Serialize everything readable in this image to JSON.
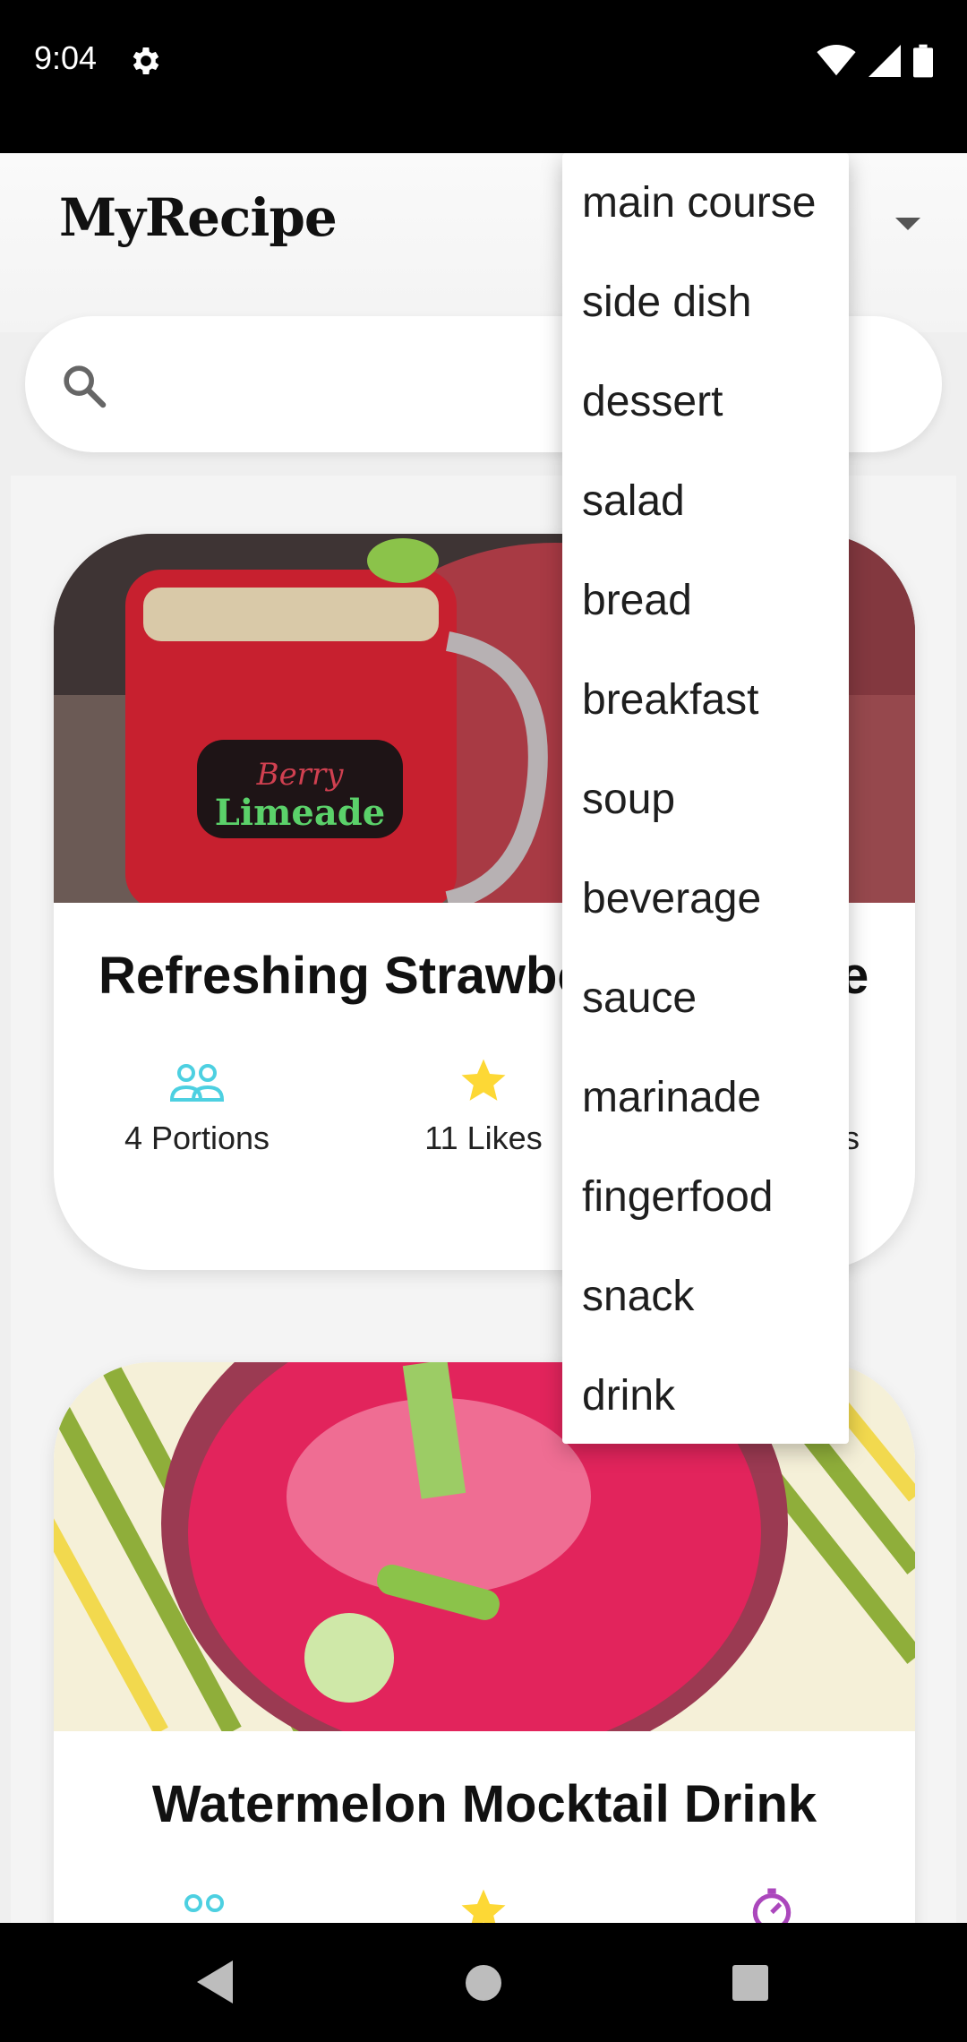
{
  "status_bar": {
    "time": "9:04",
    "icons": [
      "gear-icon",
      "wifi-icon",
      "signal-icon",
      "battery-icon"
    ]
  },
  "header": {
    "title": "MyRecipe",
    "dropdown_icon": "arrow-drop-down-icon"
  },
  "search": {
    "placeholder": "",
    "icon": "search-icon"
  },
  "category_menu": {
    "items": [
      "main course",
      "side dish",
      "dessert",
      "salad",
      "bread",
      "breakfast",
      "soup",
      "beverage",
      "sauce",
      "marinade",
      "fingerfood",
      "snack",
      "drink"
    ]
  },
  "recipes": [
    {
      "title_visible": "Refreshing Strawbe",
      "title_tail": "e",
      "image": "berry-limeade-photo",
      "image_label_top": "Berry",
      "image_label_bottom": "Limeade",
      "stats": {
        "portions": "4 Portions",
        "likes": "11 Likes",
        "third_tail": "s"
      }
    },
    {
      "title": "Watermelon Mocktail Drink",
      "image": "watermelon-mocktail-photo"
    }
  ],
  "colors": {
    "portions_icon": "#4dd0e1",
    "likes_icon": "#fdd835",
    "time_icon": "#ab47bc"
  }
}
